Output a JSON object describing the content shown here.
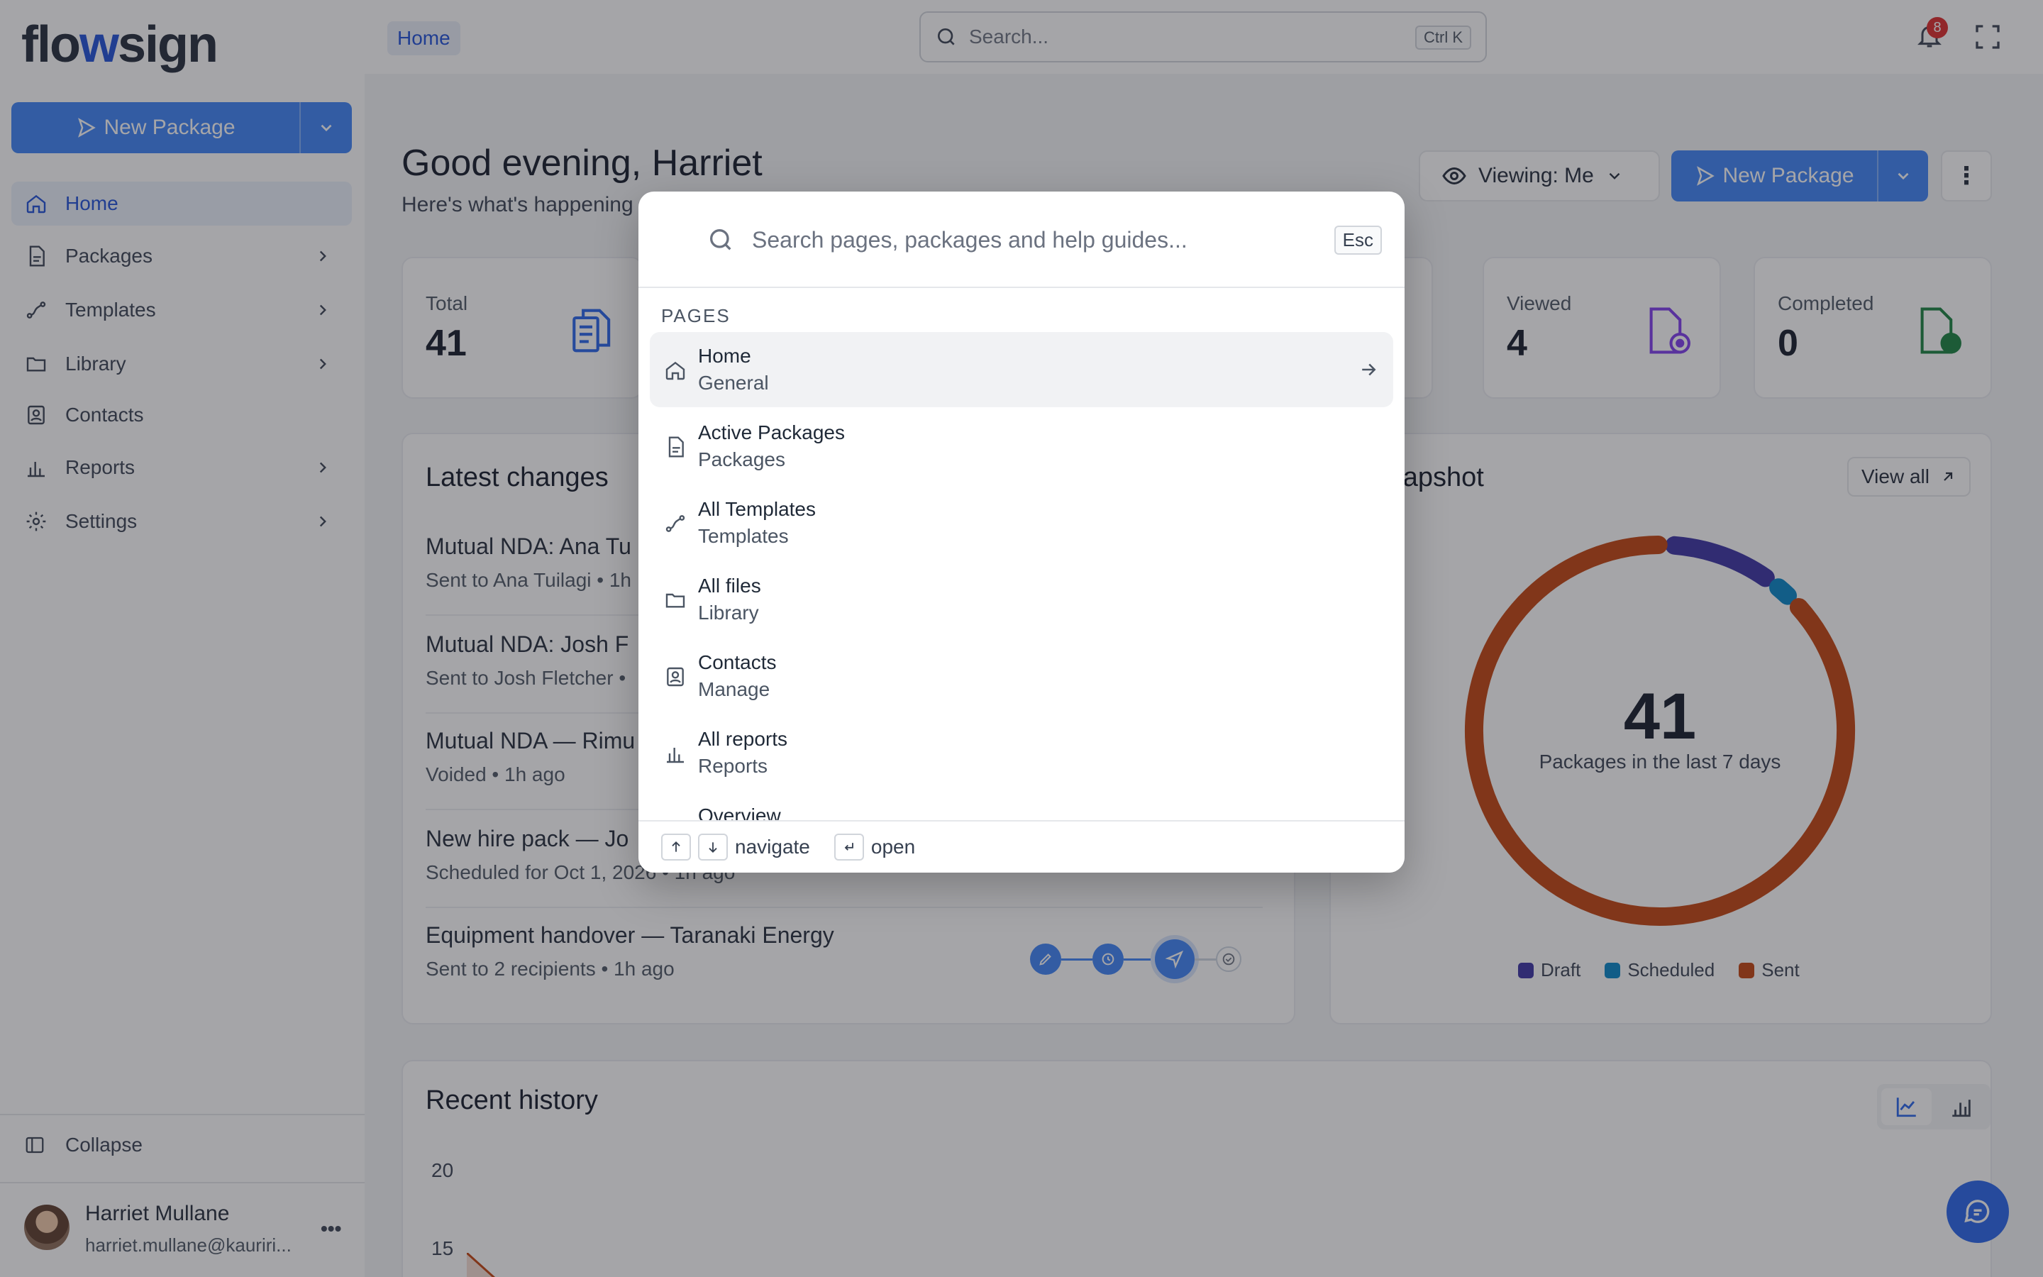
{
  "app": {
    "logo_text_a": "flo",
    "logo_text_b": "w",
    "logo_text_c": "sign"
  },
  "sidebar": {
    "new_package_label": "New Package",
    "items": [
      {
        "label": "Home"
      },
      {
        "label": "Packages"
      },
      {
        "label": "Templates"
      },
      {
        "label": "Library"
      },
      {
        "label": "Contacts"
      },
      {
        "label": "Reports"
      },
      {
        "label": "Settings"
      }
    ],
    "collapse_label": "Collapse",
    "user": {
      "name": "Harriet Mullane",
      "email": "harriet.mullane@kauriri..."
    }
  },
  "topbar": {
    "breadcrumb": "Home",
    "search_placeholder": "Search...",
    "search_shortcut": "Ctrl K",
    "notification_count": "8"
  },
  "main": {
    "greeting": "Good evening, Harriet",
    "subtitle": "Here's what's happening",
    "viewing_label": "Viewing: Me",
    "new_package_label": "New Package",
    "stats": [
      {
        "label": "Total",
        "value": "41"
      },
      {
        "label": "Viewed",
        "value": "4"
      },
      {
        "label": "Completed",
        "value": "0"
      }
    ],
    "latest_changes": {
      "title": "Latest changes",
      "rows": [
        {
          "title": "Mutual NDA: Ana Tu",
          "sub": "Sent to Ana Tuilagi • 1h"
        },
        {
          "title": "Mutual NDA: Josh F",
          "sub": "Sent to Josh Fletcher •"
        },
        {
          "title": "Mutual NDA — Rimu",
          "sub": "Voided • 1h ago"
        },
        {
          "title": "New hire pack — Jo",
          "sub": "Scheduled for Oct 1, 2026 • 1h ago"
        },
        {
          "title": "Equipment handover — Taranaki Energy",
          "sub": "Sent to 2 recipients • 1h ago"
        }
      ]
    },
    "snapshot": {
      "title": "k snapshot",
      "view_all": "View all",
      "total": "41",
      "caption": "Packages in the last 7 days",
      "legend": [
        {
          "label": "Draft",
          "color": "#3730a3"
        },
        {
          "label": "Scheduled",
          "color": "#0284c7"
        },
        {
          "label": "Sent",
          "color": "#c2410c"
        }
      ]
    },
    "recent_history": {
      "title": "Recent history",
      "y_ticks": [
        "20",
        "15"
      ]
    }
  },
  "chart_data": {
    "type": "pie",
    "categories": [
      "Draft",
      "Scheduled",
      "Sent"
    ],
    "values": [
      4,
      1,
      36
    ],
    "colors": [
      "#3730a3",
      "#0284c7",
      "#c2410c"
    ]
  },
  "palette": {
    "placeholder": "Search pages, packages and help guides...",
    "esc": "Esc",
    "section": "PAGES",
    "items": [
      {
        "title": "Home",
        "sub": "General"
      },
      {
        "title": "Active Packages",
        "sub": "Packages"
      },
      {
        "title": "All Templates",
        "sub": "Templates"
      },
      {
        "title": "All files",
        "sub": "Library"
      },
      {
        "title": "Contacts",
        "sub": "Manage"
      },
      {
        "title": "All reports",
        "sub": "Reports"
      },
      {
        "title": "Overview",
        "sub": ""
      }
    ],
    "footer": {
      "navigate": "navigate",
      "open": "open"
    }
  },
  "colors": {
    "accent": "#3b82f6",
    "brand": "#1d4ed8"
  }
}
